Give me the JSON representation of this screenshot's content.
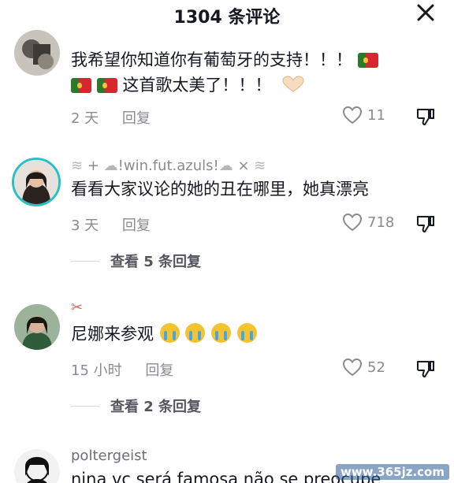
{
  "header": {
    "title": "1304 条评论",
    "close_icon": "close-icon"
  },
  "comments": [
    {
      "username": "",
      "text_line1": "我希望你知道你有葡萄牙的支持！！！",
      "text_line2": "这首歌太美了！！！",
      "time": "2 天",
      "reply_label": "回复",
      "likes": "11",
      "icons": [
        "portugal-flag-icon",
        "heart-hands-icon",
        "heart-outline-icon",
        "dislike-icon"
      ]
    },
    {
      "username": "!win.fut.azuls!",
      "text_line1": "看看大家议论的她的丑在哪里，她真漂亮",
      "time": "3 天",
      "reply_label": "回复",
      "likes": "718",
      "view_replies": "查看 5 条回复",
      "icons": [
        "tornado-icon",
        "cloud-rain-icon",
        "heart-outline-icon",
        "dislike-icon"
      ]
    },
    {
      "username": "",
      "text_line1": "尼娜来参观",
      "time": "15 小时",
      "reply_label": "回复",
      "likes": "52",
      "view_replies": "查看 2 条回复",
      "icons": [
        "scissors-icon",
        "crying-face-icon",
        "heart-outline-icon",
        "dislike-icon"
      ]
    },
    {
      "username": "poltergeist",
      "text_line1": "nina vc será famosa não se preocupe"
    }
  ],
  "watermark": "www.365jz.com",
  "colors": {
    "text": "#161823",
    "secondary": "#8a8b91",
    "divider": "#d7d8dc",
    "flag_green": "#2a7a2a",
    "flag_red": "#d7262f"
  }
}
